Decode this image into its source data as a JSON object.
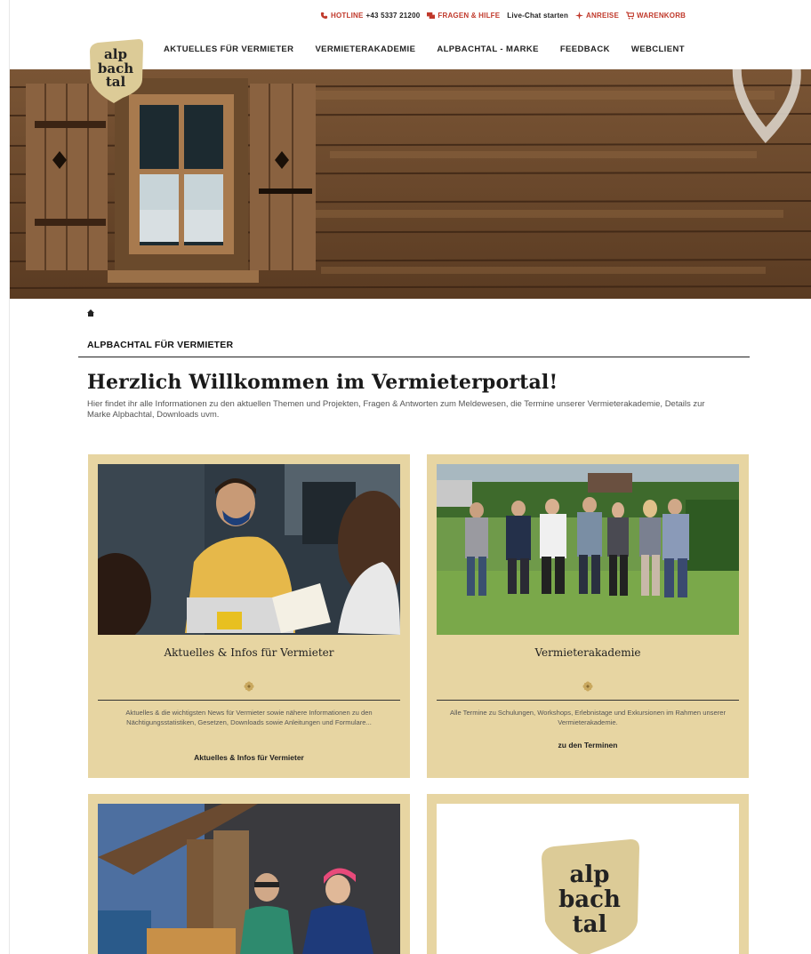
{
  "topbar": {
    "hotline_label": "HOTLINE",
    "hotline_number": "+43 5337 21200",
    "faq_label": "FRAGEN & HILFE",
    "chat_label": "Live-Chat starten",
    "arrival_label": "ANREISE",
    "cart_label": "WARENKORB"
  },
  "logo": {
    "line1": "alp",
    "line2": "bach",
    "line3": "tal"
  },
  "nav": {
    "items": [
      "AKTUELLES FÜR VERMIETER",
      "VERMIETERAKADEMIE",
      "ALPBACHTAL - MARKE",
      "FEEDBACK",
      "WEBCLIENT"
    ]
  },
  "section": {
    "label": "ALPBACHTAL FÜR VERMIETER"
  },
  "welcome": {
    "title": "Herzlich Willkommen im Vermieterportal!",
    "text": "Hier findet ihr alle Informationen zu den aktuellen Themen und Projekten, Fragen & Antworten zum Meldewesen, die Termine unserer Vermieterakademie, Details zur Marke Alpbachtal, Downloads uvm."
  },
  "cards": [
    {
      "title": "Aktuelles & Infos für Vermieter",
      "desc": "Aktuelles & die wichtigsten News für Vermieter sowie nähere Informationen zu den Nächtigungsstatistiken, Gesetzen, Downloads sowie Anleitungen und Formulare...",
      "link": "Aktuelles & Infos für Vermieter"
    },
    {
      "title": "Vermieterakademie",
      "desc": "Alle Termine zu Schulungen, Workshops, Erlebnistage und Exkursionen im Rahmen unserer Vermieterakademie.",
      "link": "zu den Terminen"
    }
  ],
  "colors": {
    "accent_red": "#c0392b",
    "card_bg": "#e7d5a2",
    "logo_bg": "#dccb97"
  }
}
